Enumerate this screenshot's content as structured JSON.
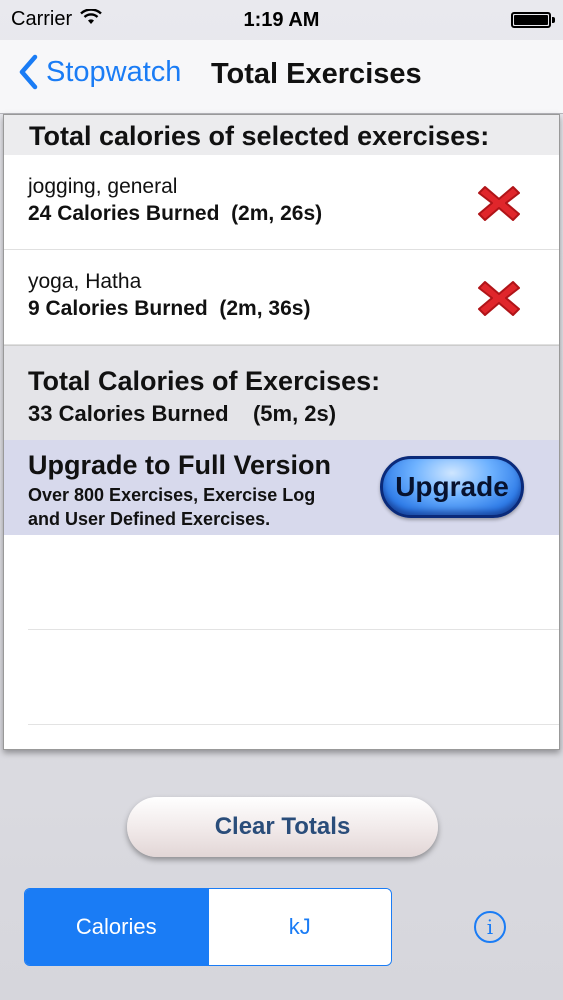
{
  "status_bar": {
    "carrier": "Carrier",
    "time": "1:19 AM"
  },
  "nav": {
    "back_label": "Stopwatch",
    "title": "Total Exercises"
  },
  "selected": {
    "header": "Total calories of selected exercises:",
    "exercises": [
      {
        "name": "jogging, general",
        "detail": "24 Calories Burned  (2m, 26s)"
      },
      {
        "name": "yoga, Hatha",
        "detail": "9 Calories Burned  (2m, 36s)"
      }
    ]
  },
  "total": {
    "heading": "Total Calories of Exercises:",
    "value": "33 Calories Burned    (5m, 2s)"
  },
  "upgrade": {
    "title": "Upgrade to Full Version",
    "line1": "Over 800 Exercises, Exercise Log",
    "line2": "and User Defined Exercises.",
    "button_label": "Upgrade"
  },
  "footer": {
    "clear_label": "Clear Totals",
    "segments": [
      {
        "label": "Calories",
        "selected": true
      },
      {
        "label": "kJ",
        "selected": false
      }
    ],
    "info_glyph": "i"
  },
  "colors": {
    "accent": "#1a7cf5",
    "delete_red": "#e0262b",
    "upgrade_band": "#d7d9ec"
  }
}
